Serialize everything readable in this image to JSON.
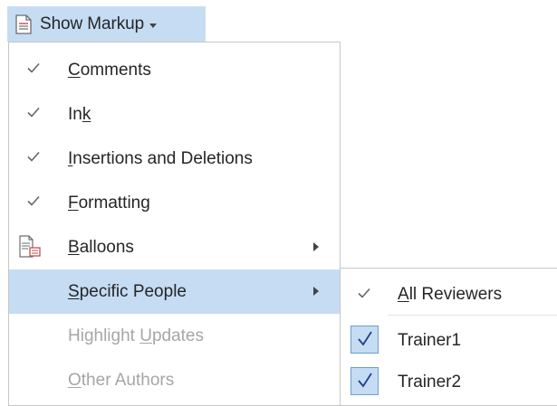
{
  "button": {
    "label": "Show Markup",
    "icon": "document-icon",
    "accent": "#c5dcf3"
  },
  "menu": {
    "items": [
      {
        "pre": "",
        "mnemonic": "C",
        "post": "omments",
        "checked": true
      },
      {
        "pre": "In",
        "mnemonic": "k",
        "post": "",
        "checked": true
      },
      {
        "pre": "",
        "mnemonic": "I",
        "post": "nsertions and Deletions",
        "checked": true
      },
      {
        "pre": "",
        "mnemonic": "F",
        "post": "ormatting",
        "checked": true
      },
      {
        "pre": "",
        "mnemonic": "B",
        "post": "alloons",
        "checked": false,
        "icon": "balloons-icon",
        "submenu": true
      },
      {
        "pre": "",
        "mnemonic": "S",
        "post": "pecific People",
        "checked": false,
        "submenu": true,
        "highlighted": true
      },
      {
        "pre": "Highlight ",
        "mnemonic": "U",
        "post": "pdates",
        "disabled": true
      },
      {
        "pre": "",
        "mnemonic": "O",
        "post": "ther Authors",
        "disabled": true
      }
    ]
  },
  "submenu": {
    "items": [
      {
        "pre": "",
        "mnemonic": "A",
        "post": "ll Reviewers",
        "checked": true,
        "style": "check"
      },
      {
        "pre": "",
        "mnemonic": "",
        "post": "Trainer1",
        "checked": true,
        "style": "checkbox"
      },
      {
        "pre": "",
        "mnemonic": "",
        "post": "Trainer2",
        "checked": true,
        "style": "checkbox"
      }
    ]
  },
  "colors": {
    "highlight": "#c5dcf3",
    "disabled_text": "#a6a6a6",
    "checkbox_border": "#6c9dd2",
    "checkbox_check": "#1f3f8a"
  }
}
